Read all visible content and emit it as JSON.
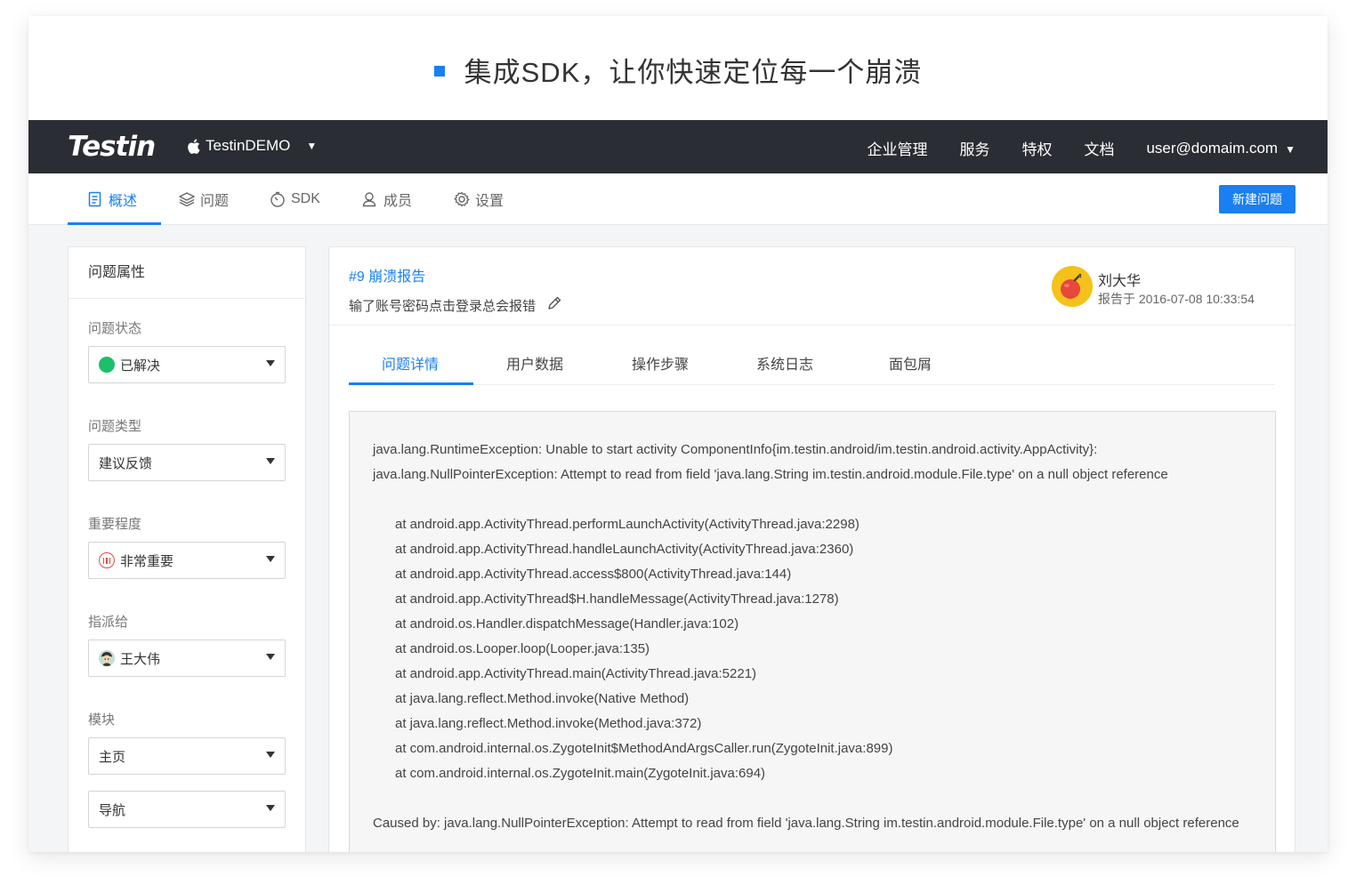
{
  "banner": {
    "title": "集成SDK，让你快速定位每一个崩溃"
  },
  "topbar": {
    "logo": "Testin",
    "project": "TestinDEMO",
    "links": [
      "企业管理",
      "服务",
      "特权",
      "文档"
    ],
    "user": "user@domaim.com"
  },
  "subnav": {
    "tabs": [
      {
        "label": "概述",
        "icon": "document-icon"
      },
      {
        "label": "问题",
        "icon": "layers-icon"
      },
      {
        "label": "SDK",
        "icon": "timer-icon"
      },
      {
        "label": "成员",
        "icon": "user-icon"
      },
      {
        "label": "设置",
        "icon": "gear-icon"
      }
    ],
    "active_tab": "概述",
    "new_button": "新建问题"
  },
  "sidebar": {
    "title": "问题属性",
    "status": {
      "label": "问题状态",
      "value": "已解决"
    },
    "type": {
      "label": "问题类型",
      "value": "建议反馈"
    },
    "priority": {
      "label": "重要程度",
      "value": "非常重要"
    },
    "assignee": {
      "label": "指派给",
      "value": "王大伟"
    },
    "module": {
      "label": "模块",
      "value": "主页",
      "sub_value": "导航"
    }
  },
  "issue": {
    "id_title": "#9 崩溃报告",
    "description": "输了账号密码点击登录总会报错",
    "reporter": "刘大华",
    "reported_at": "报告于 2016-07-08   10:33:54",
    "tabs": [
      "问题详情",
      "用户数据",
      "操作步骤",
      "系统日志",
      "面包屑"
    ],
    "active_tab": "问题详情"
  },
  "log": {
    "header_lines": [
      "java.lang.RuntimeException: Unable to start activity ComponentInfo{im.testin.android/im.testin.android.activity.AppActivity}:",
      "java.lang.NullPointerException: Attempt to read from field 'java.lang.String im.testin.android.module.File.type' on a null object reference"
    ],
    "stack": [
      "at android.app.ActivityThread.performLaunchActivity(ActivityThread.java:2298)",
      "at android.app.ActivityThread.handleLaunchActivity(ActivityThread.java:2360)",
      "at android.app.ActivityThread.access$800(ActivityThread.java:144)",
      "at android.app.ActivityThread$H.handleMessage(ActivityThread.java:1278)",
      "at android.os.Handler.dispatchMessage(Handler.java:102)",
      "at android.os.Looper.loop(Looper.java:135)",
      "at android.app.ActivityThread.main(ActivityThread.java:5221)",
      "at java.lang.reflect.Method.invoke(Native Method)",
      "at java.lang.reflect.Method.invoke(Method.java:372)",
      "at com.android.internal.os.ZygoteInit$MethodAndArgsCaller.run(ZygoteInit.java:899)",
      "at com.android.internal.os.ZygoteInit.main(ZygoteInit.java:694)"
    ],
    "caused_by": "Caused by: java.lang.NullPointerException: Attempt to read from field 'java.lang.String im.testin.android.module.File.type' on a null object reference"
  },
  "colors": {
    "accent": "#1a7ff0",
    "topbar": "#2a2d33",
    "resolved": "#1cbf6a",
    "important": "#e44b3b"
  }
}
